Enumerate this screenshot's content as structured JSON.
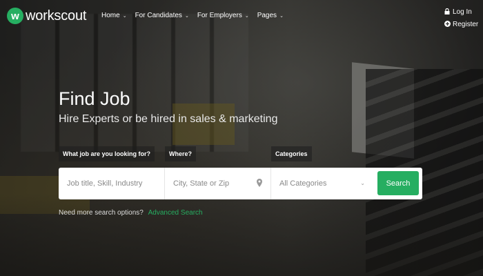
{
  "brand": {
    "logo_letter": "w",
    "name": "workscout",
    "accent": "#26ae61"
  },
  "nav": {
    "items": [
      {
        "label": "Home",
        "icon": "chevron-down-icon"
      },
      {
        "label": "For Candidates",
        "icon": "chevron-down-icon"
      },
      {
        "label": "For Employers",
        "icon": "chevron-down-icon"
      },
      {
        "label": "Pages",
        "icon": "chevron-down-icon"
      }
    ],
    "chevron": "⌄"
  },
  "auth": {
    "login": {
      "label": "Log In",
      "icon": "lock-icon",
      "glyph": "🔒"
    },
    "register": {
      "label": "Register",
      "icon": "plus-circle-icon",
      "glyph": "⊕"
    }
  },
  "hero": {
    "title": "Find Job",
    "subtitle": "Hire Experts or be hired in sales & marketing"
  },
  "search": {
    "labels": {
      "what": "What job are you looking for?",
      "where": "Where?",
      "categories": "Categories"
    },
    "job_placeholder": "Job title, Skill, Industry",
    "location_placeholder": "City, State or Zip",
    "category_selected": "All Categories",
    "button": "Search"
  },
  "more": {
    "text": "Need more search options?",
    "link": "Advanced Search"
  }
}
